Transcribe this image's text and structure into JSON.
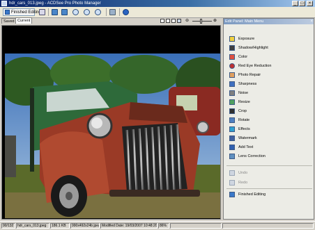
{
  "window": {
    "title": "hdr_cars_013.jpeg - ACDSee Pro Photo Manager",
    "controls": [
      "_",
      "□",
      "×"
    ]
  },
  "toolbar": {
    "finish_label": "Finished Editing",
    "icons": [
      "save-icon",
      "previous-image-icon",
      "next-image-icon",
      "zoom-in-icon",
      "zoom-out-icon",
      "zoom-fit-icon",
      "rotate-icon",
      "help-icon"
    ]
  },
  "tabs": [
    {
      "label": "Saved",
      "active": false
    },
    {
      "label": "Current",
      "active": true
    }
  ],
  "zoom": {
    "minus": "⊖",
    "plus": "⊕"
  },
  "panel": {
    "title": "Edit Panel: Main Menu",
    "close": "×",
    "tools": [
      {
        "label": "Exposure",
        "icon": "exposure-icon",
        "color": "#f0d040"
      },
      {
        "label": "Shadow/Highlight",
        "icon": "shadow-highlight-icon",
        "color": "#404040"
      },
      {
        "label": "Color",
        "icon": "color-icon",
        "color": "#e05040"
      },
      {
        "label": "Red Eye Reduction",
        "icon": "red-eye-icon",
        "color": "#c03030"
      },
      {
        "label": "Photo Repair",
        "icon": "photo-repair-icon",
        "color": "#e0a060"
      },
      {
        "label": "Sharpness",
        "icon": "sharpness-icon",
        "color": "#4070c0"
      },
      {
        "label": "Noise",
        "icon": "noise-icon",
        "color": "#808080"
      },
      {
        "label": "Resize",
        "icon": "resize-icon",
        "color": "#50a060"
      },
      {
        "label": "Crop",
        "icon": "crop-icon",
        "color": "#303030"
      },
      {
        "label": "Rotate",
        "icon": "rotate-icon",
        "color": "#5080c0"
      },
      {
        "label": "Effects",
        "icon": "effects-icon",
        "color": "#30a0d0"
      },
      {
        "label": "Watermark",
        "icon": "watermark-icon",
        "color": "#4060a0"
      },
      {
        "label": "Add Text",
        "icon": "add-text-icon",
        "color": "#3060b0"
      },
      {
        "label": "Lens Correction",
        "icon": "lens-correction-icon",
        "color": "#6090c0"
      }
    ],
    "history": [
      {
        "label": "Undo",
        "icon": "undo-icon"
      },
      {
        "label": "Redo",
        "icon": "redo-icon"
      }
    ],
    "finish_label": "Finished Editing"
  },
  "status": {
    "index": "90/132",
    "filename": "hdr_cars_013.jpeg",
    "filesize": "186.1 KB",
    "dimensions": "990x492x24b jpeg",
    "modified": "Modified Date: 19/03/2007 10:48:20",
    "zoom": "86%"
  }
}
